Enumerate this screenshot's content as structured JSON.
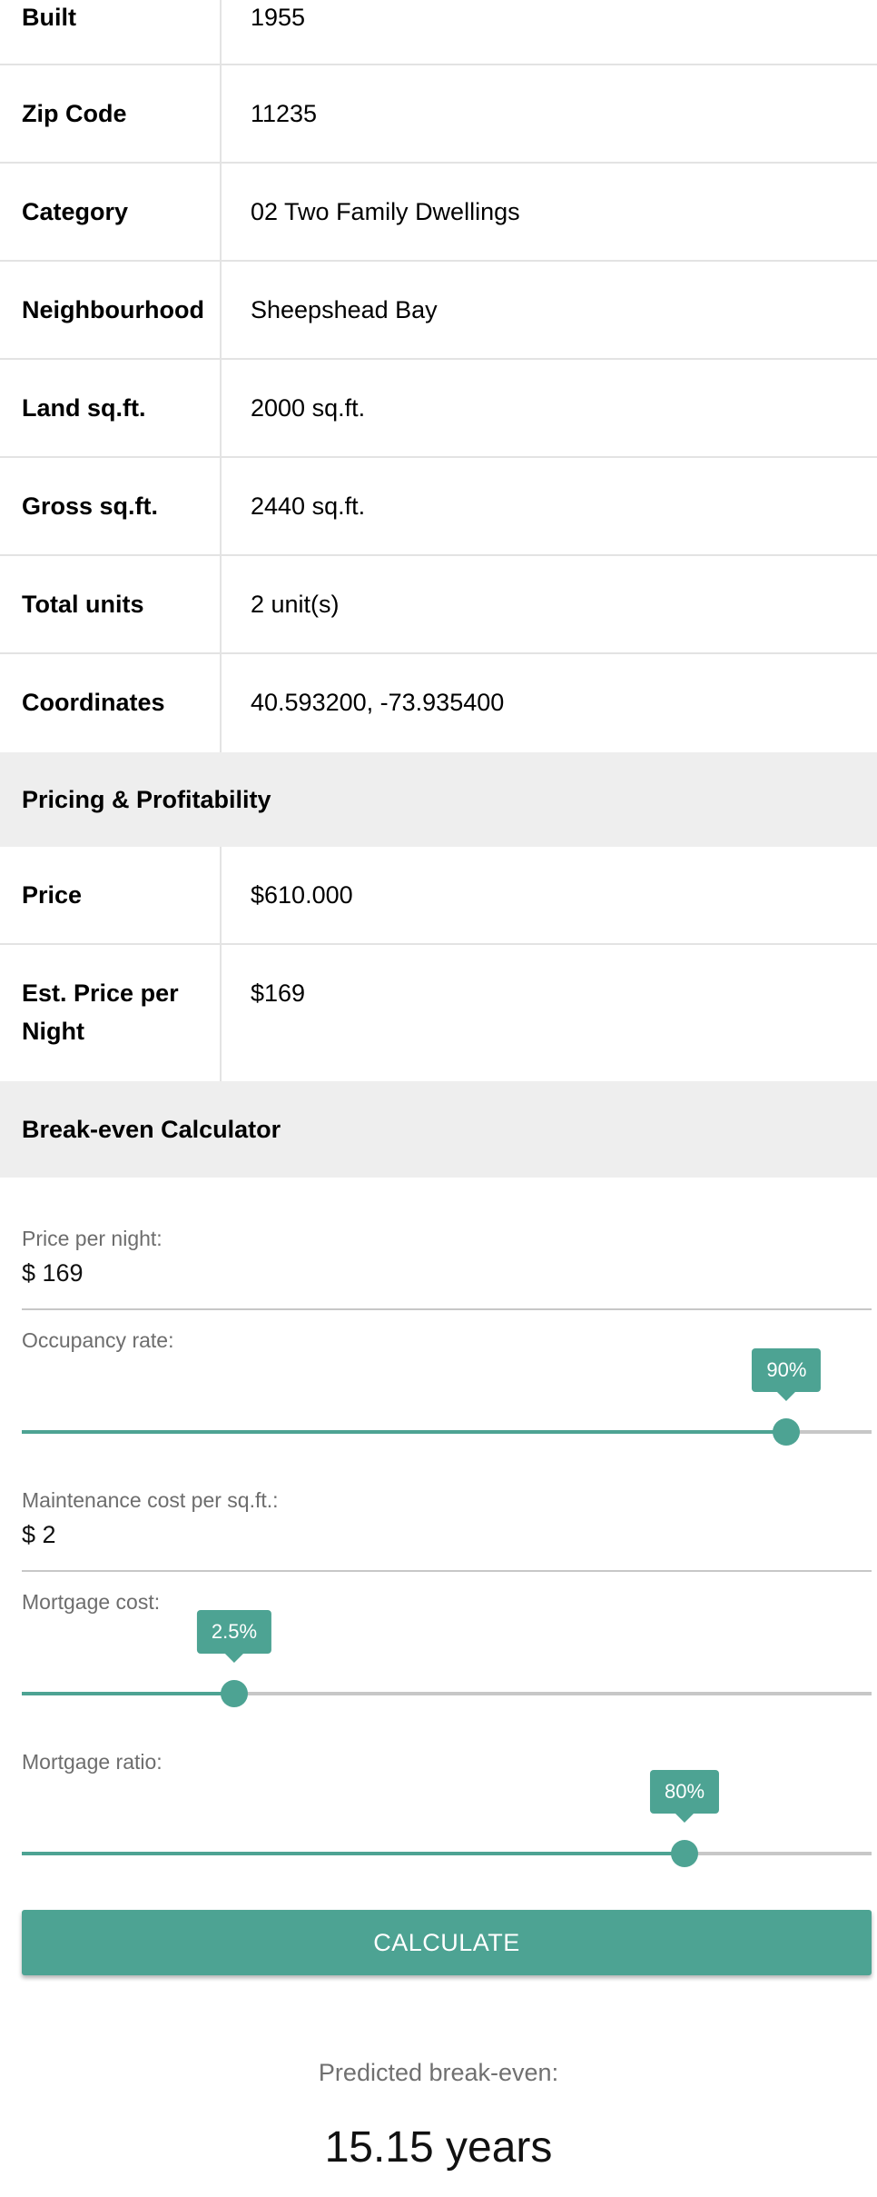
{
  "details": {
    "rows": [
      {
        "label": "Built",
        "value": "1955"
      },
      {
        "label": "Zip Code",
        "value": "11235"
      },
      {
        "label": "Category",
        "value": "02 Two Family Dwellings"
      },
      {
        "label": "Neighbourhood",
        "value": "Sheepshead Bay"
      },
      {
        "label": "Land sq.ft.",
        "value": "2000 sq.ft."
      },
      {
        "label": "Gross sq.ft.",
        "value": "2440 sq.ft."
      },
      {
        "label": "Total units",
        "value": "2 unit(s)"
      },
      {
        "label": "Coordinates",
        "value": "40.593200, -73.935400"
      }
    ]
  },
  "pricing": {
    "title": "Pricing & Profitability",
    "rows": [
      {
        "label": "Price",
        "value": "$610.000"
      },
      {
        "label": "Est. Price per Night",
        "value": "$169"
      }
    ]
  },
  "calculator": {
    "title": "Break-even Calculator",
    "price_per_night": {
      "label": "Price per night:",
      "value": "$ 169"
    },
    "occupancy": {
      "label": "Occupancy rate:",
      "value_label": "90%",
      "level": 0.9
    },
    "maintenance": {
      "label": "Maintenance cost per sq.ft.:",
      "value": "$ 2"
    },
    "mortgage_cost": {
      "label": "Mortgage cost:",
      "value_label": "2.5%",
      "level": 0.25
    },
    "mortgage_ratio": {
      "label": "Mortgage ratio:",
      "value_label": "80%",
      "level": 0.78
    },
    "calculate_label": "Calculate",
    "result_label": "Predicted break-even:",
    "result_value": "15.15 years"
  },
  "colors": {
    "accent": "#4da393",
    "section_bg": "#eeeeee",
    "divider": "#e3e3e3"
  }
}
